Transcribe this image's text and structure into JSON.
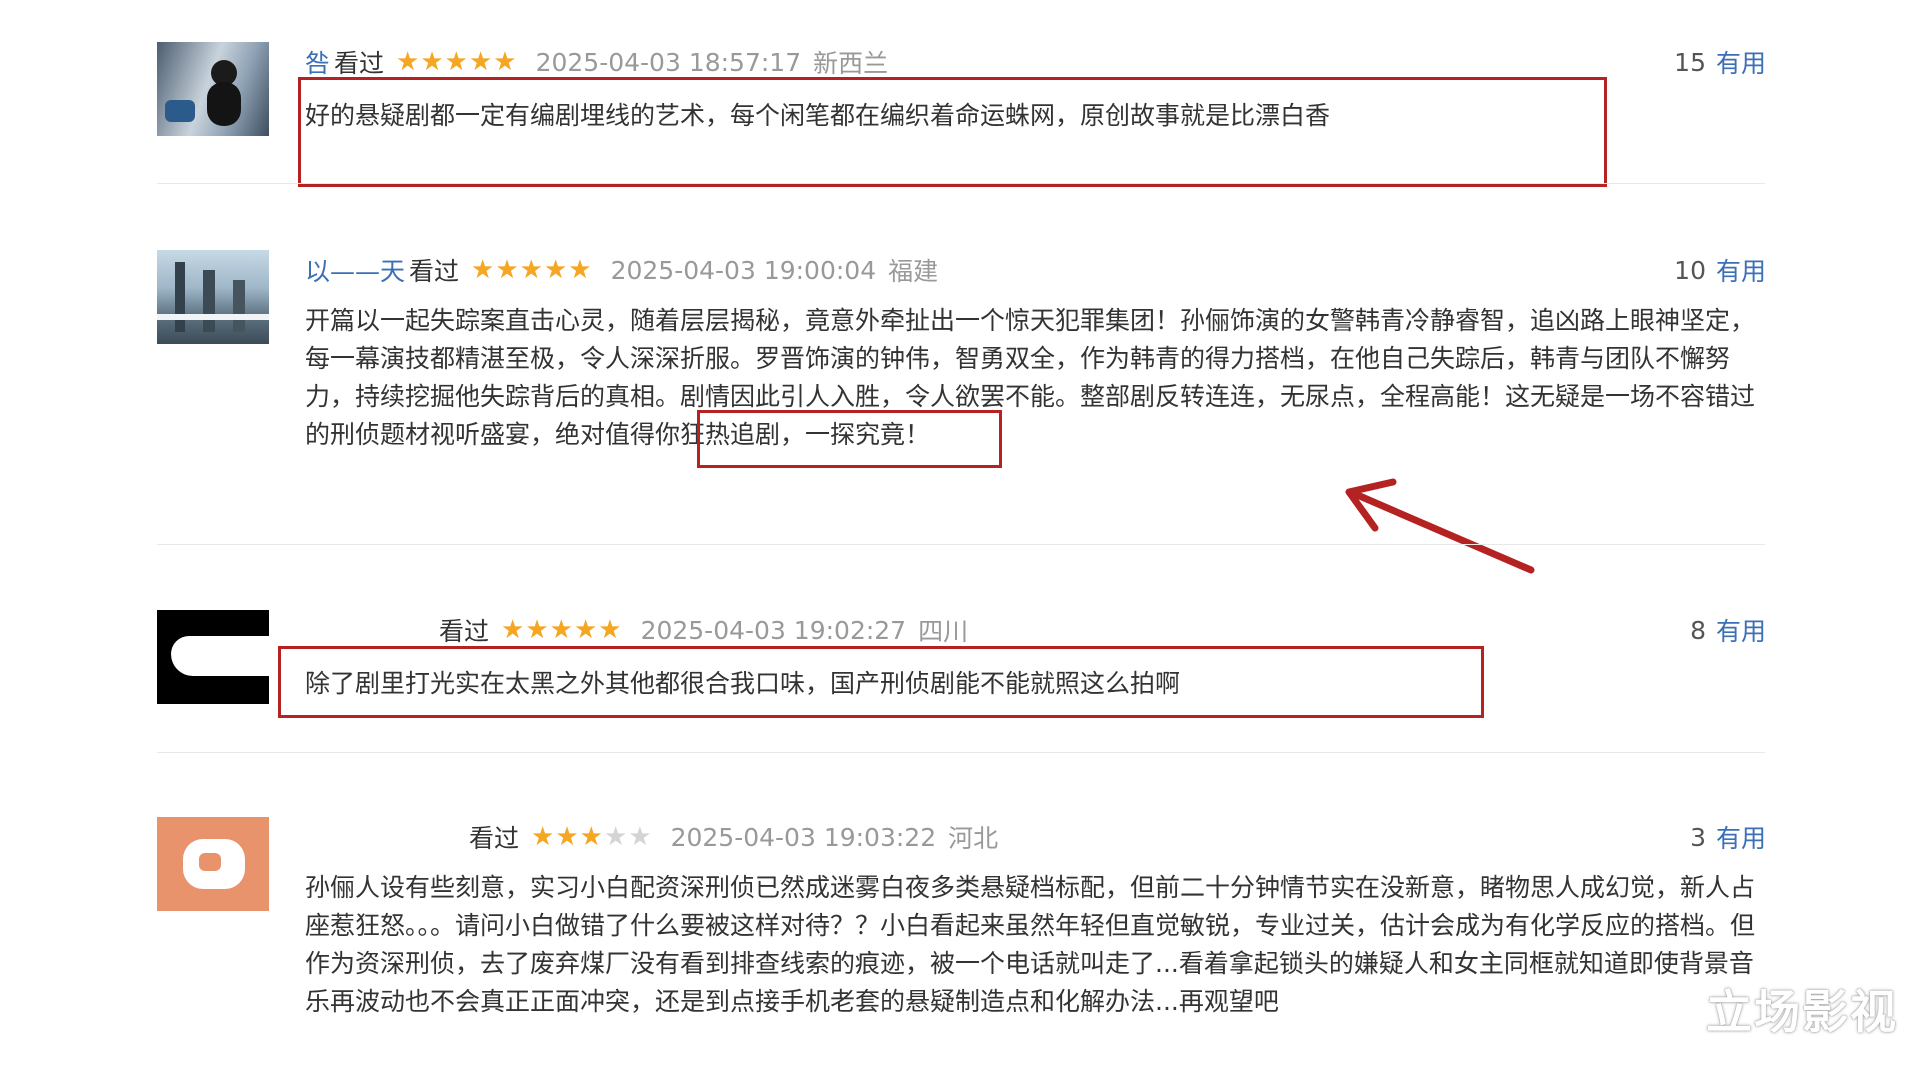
{
  "reviews": [
    {
      "user": "咎",
      "watched": "看过",
      "stars_on": "★★★★★",
      "stars_off": "",
      "date": "2025-04-03 18:57:17",
      "location": "新西兰",
      "useful_count": "15",
      "useful_label": "有用",
      "content": "好的悬疑剧都一定有编剧埋线的艺术，每个闲笔都在编织着命运蛛网，原创故事就是比漂白香"
    },
    {
      "user": "以——天",
      "watched": "看过",
      "stars_on": "★★★★★",
      "stars_off": "",
      "date": "2025-04-03 19:00:04",
      "location": "福建",
      "useful_count": "10",
      "useful_label": "有用",
      "content": "开篇以一起失踪案直击心灵，随着层层揭秘，竟意外牵扯出一个惊天犯罪集团！孙俪饰演的女警韩青冷静睿智，追凶路上眼神坚定，每一幕演技都精湛至极，令人深深折服。罗晋饰演的钟伟，智勇双全，作为韩青的得力搭档，在他自己失踪后，韩青与团队不懈努力，持续挖掘他失踪背后的真相。剧情因此引人入胜，令人欲罢不能。整部剧反转连连，无尿点，全程高能！这无疑是一场不容错过的刑侦题材视听盛宴，绝对值得你狂热追剧，一探究竟！"
    },
    {
      "user": "",
      "watched": "看过",
      "stars_on": "★★★★★",
      "stars_off": "",
      "date": "2025-04-03 19:02:27",
      "location": "四川",
      "useful_count": "8",
      "useful_label": "有用",
      "content": "除了剧里打光实在太黑之外其他都很合我口味，国产刑侦剧能不能就照这么拍啊"
    },
    {
      "user": "",
      "watched": "看过",
      "stars_on": "★★★",
      "stars_off": "★★",
      "date": "2025-04-03 19:03:22",
      "location": "河北",
      "useful_count": "3",
      "useful_label": "有用",
      "content": "孙俪人设有些刻意，实习小白配资深刑侦已然成迷雾白夜多类悬疑档标配，但前二十分钟情节实在没新意，睹物思人成幻觉，新人占座惹狂怒。。。请问小白做错了什么要被这样对待？？小白看起来虽然年轻但直觉敏锐，专业过关，估计会成为有化学反应的搭档。但作为资深刑侦，去了废弃煤厂没有看到排查线索的痕迹，被一个电话就叫走了...看着拿起锁头的嫌疑人和女主同框就知道即使背景音乐再波动也不会真正正面冲突，还是到点接手机老套的悬疑制造点和化解办法...再观望吧"
    }
  ],
  "watermark": "立场影视",
  "colors": {
    "highlight_box": "#b52222",
    "arrow": "#b52222",
    "star_on": "#f5a623",
    "star_off": "#d4d4d4",
    "link_blue": "#3b6fb6"
  }
}
